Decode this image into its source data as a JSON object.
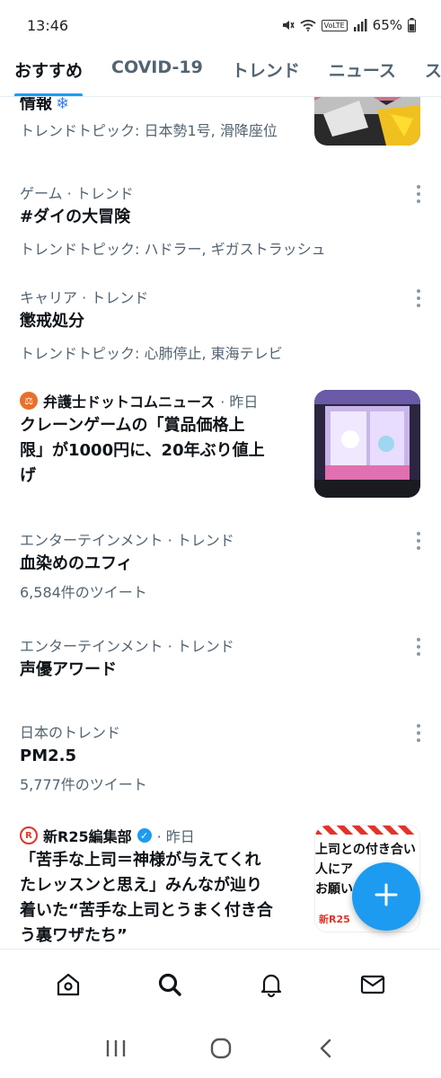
{
  "status_bar": {
    "time": "13:46",
    "battery": "65%",
    "network": "VoLTE"
  },
  "tabs": [
    {
      "label": "おすすめ",
      "active": true
    },
    {
      "label": "COVID-19",
      "active": false
    },
    {
      "label": "トレンド",
      "active": false
    },
    {
      "label": "ニュース",
      "active": false
    },
    {
      "label": "ス",
      "active": false
    }
  ],
  "feed": {
    "partial": {
      "title": "情報",
      "subtitle": "トレンドトピック: 日本勢1号, 滑降座位"
    },
    "trends": [
      {
        "category": "ゲーム · トレンド",
        "title": "#ダイの大冒険",
        "subtitle": "トレンドトピック: ハドラー, ギガストラッシュ"
      },
      {
        "category": "キャリア · トレンド",
        "title": "懲戒処分",
        "subtitle": "トレンドトピック: 心肺停止, 東海テレビ"
      },
      {
        "category": "エンターテインメント · トレンド",
        "title": "血染めのユフィ",
        "subtitle": "6,584件のツイート"
      },
      {
        "category": "エンターテインメント · トレンド",
        "title": "声優アワード",
        "subtitle": ""
      },
      {
        "category": "日本のトレンド",
        "title": "PM2.5",
        "subtitle": "5,777件のツイート"
      }
    ],
    "news": [
      {
        "source": "弁護士ドットコムニュース",
        "time": "· 昨日",
        "title_lines": [
          "クレーンゲームの「賞品価格上",
          "限」が1000円に、20年ぶり値上",
          "げ"
        ]
      },
      {
        "source": "新R25編集部",
        "time": "· 昨日",
        "verified": true,
        "title_lines": [
          "「苦手な上司＝神様が与えてくれ",
          "たレッスンと思え」みんなが辿り",
          "着いた“苦手な上司とうまく付き合",
          "う裏ワザたち”"
        ],
        "thumb_text": [
          "上司との付き合い",
          "人にア",
          "お願い"
        ],
        "thumb_brand": "新R25"
      }
    ]
  },
  "icons": {
    "fab": "compose-plus-icon",
    "nav": [
      "home-icon",
      "search-icon",
      "notifications-bell-icon",
      "messages-envelope-icon"
    ],
    "android": [
      "recents-icon",
      "home-circle-icon",
      "back-icon"
    ]
  },
  "colors": {
    "accent": "#1d9bf0",
    "text_primary": "#0f1419",
    "text_secondary": "#536471"
  }
}
